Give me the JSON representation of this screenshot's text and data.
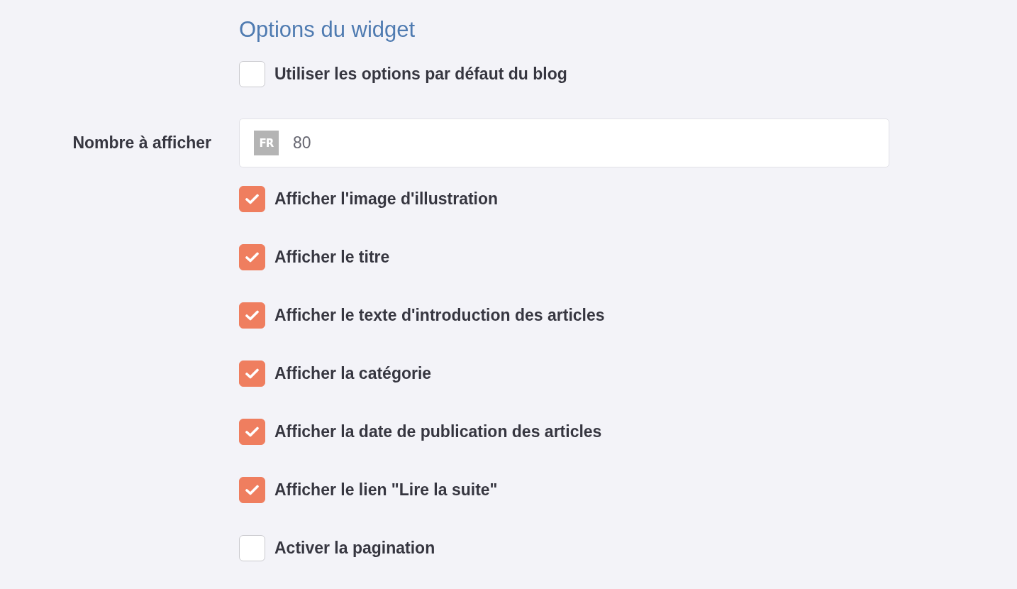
{
  "section": {
    "title": "Options du widget"
  },
  "use_defaults": {
    "label": "Utiliser les options par défaut du blog",
    "checked": false
  },
  "number_field": {
    "label": "Nombre à afficher",
    "language_badge": "FR",
    "value": "80"
  },
  "options": [
    {
      "label": "Afficher l'image d'illustration",
      "checked": true
    },
    {
      "label": "Afficher le titre",
      "checked": true
    },
    {
      "label": "Afficher le texte d'introduction des articles",
      "checked": true
    },
    {
      "label": "Afficher la catégorie",
      "checked": true
    },
    {
      "label": "Afficher la date de publication des articles",
      "checked": true
    },
    {
      "label": "Afficher le lien \"Lire la suite\"",
      "checked": true
    },
    {
      "label": "Activer la pagination",
      "checked": false
    }
  ]
}
